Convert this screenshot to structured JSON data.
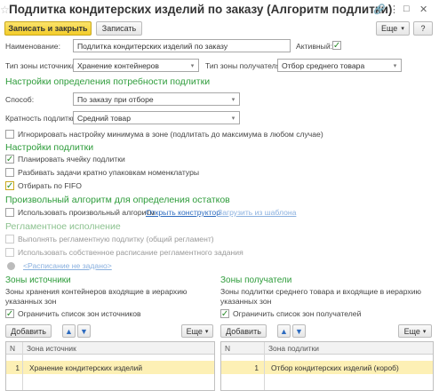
{
  "window": {
    "title": "Подлитка кондитерских изделий по заказу (Алгоритм подлитки)",
    "star_icon": "star-icon",
    "link_icon": "link-icon",
    "more_icon": "more-icon",
    "maximize_icon": "maximize-icon",
    "close_icon": "close-icon"
  },
  "toolbar": {
    "save_close_label": "Записать и закрыть",
    "save_label": "Записать",
    "more_label": "Еще",
    "help_label": "?"
  },
  "main": {
    "name_label": "Наименование:",
    "name_value": "Подлитка кондитерских изделий по заказу",
    "active_label": "Активный:",
    "active_checked": true,
    "source_zone_type_label": "Тип зоны источника:",
    "source_zone_type_value": "Хранение контейнеров",
    "dest_zone_type_label": "Тип зоны получателя:",
    "dest_zone_type_value": "Отбор среднего товара"
  },
  "need_section": {
    "title": "Настройки определения потребности подлитки",
    "method_label": "Способ:",
    "method_value": "По заказу при отборе",
    "multiplicity_label": "Кратность подлитки:",
    "multiplicity_value": "Средний товар",
    "ignore_min_label": "Игнорировать настройку минимума в зоне (подлитать до максимума в любом случае)",
    "ignore_min_checked": false
  },
  "settings_section": {
    "title": "Настройки подлитки",
    "plan_cell_label": "Планировать ячейку подлитки",
    "plan_cell_checked": true,
    "split_tasks_label": "Разбивать задачи кратно упаковкам номенклатуры",
    "split_tasks_checked": false,
    "fifo_label": "Отбирать по FIFO",
    "fifo_checked": true
  },
  "algorithm_section": {
    "title": "Произвольный алгоритм для определения остатков",
    "use_custom_label": "Использовать произвольный алгоритм",
    "use_custom_checked": false,
    "open_constructor_link": "Открыть конструктор",
    "load_template_link": "Загрузить из шаблона"
  },
  "regulation_section": {
    "title": "Регламентное исполнение",
    "run_reg_label": "Выполнять регламентную подлитку (общий регламент)",
    "own_schedule_label": "Использовать собственное расписание регламентного задания",
    "schedule_link": "<Расписание не задано>"
  },
  "source_panel": {
    "title": "Зоны источники",
    "description": "Зоны хранения контейнеров входящие в иерархию указанных зон",
    "restrict_label": "Ограничить список зон источников",
    "restrict_checked": true,
    "add_label": "Добавить",
    "more_label": "Еще",
    "columns": [
      "N",
      "Зона источник"
    ],
    "rows": [
      {
        "n": "1",
        "zone": "Хранение кондитерских изделий"
      }
    ]
  },
  "dest_panel": {
    "title": "Зоны получатели",
    "description": "Зоны подлитки среднего товара и входящие в иерархию указанных зон",
    "restrict_label": "Ограничить список зон получателей",
    "restrict_checked": true,
    "add_label": "Добавить",
    "more_label": "Еще",
    "columns": [
      "N",
      "Зона подлитки"
    ],
    "rows": [
      {
        "n": "1",
        "zone": "Отбор кондитерских изделий (короб)"
      }
    ]
  },
  "colors": {
    "section_green": "#2e9c3b",
    "primary_yellow": "#f3cd2b",
    "link_blue": "#2d6bbf",
    "row_highlight": "#fdf0b5"
  }
}
